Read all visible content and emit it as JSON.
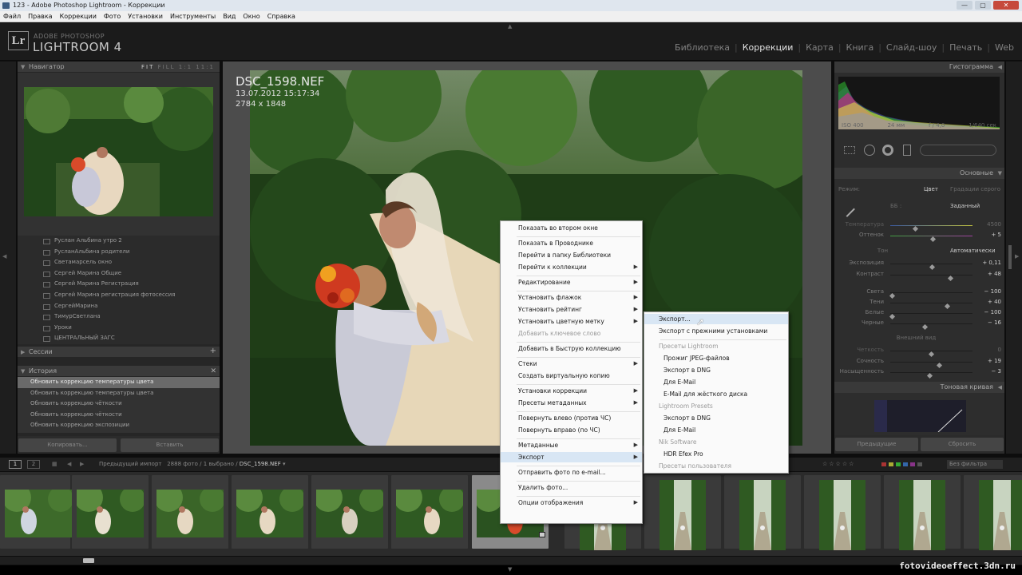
{
  "window": {
    "title": "123 - Adobe Photoshop Lightroom - Коррекции",
    "buttons": [
      "—",
      "▢",
      "✕"
    ]
  },
  "menubar": [
    "Файл",
    "Правка",
    "Коррекции",
    "Фото",
    "Установки",
    "Инструменты",
    "Вид",
    "Окно",
    "Справка"
  ],
  "app": {
    "logo": "Lr",
    "vendor": "ADOBE PHOTOSHOP",
    "name": "LIGHTROOM 4"
  },
  "modules": [
    {
      "label": "Библиотека",
      "active": false
    },
    {
      "label": "Коррекции",
      "active": true
    },
    {
      "label": "Карта",
      "active": false
    },
    {
      "label": "Книга",
      "active": false
    },
    {
      "label": "Слайд-шоу",
      "active": false
    },
    {
      "label": "Печать",
      "active": false
    },
    {
      "label": "Web",
      "active": false
    }
  ],
  "navigator": {
    "title": "Навигатор",
    "opts": [
      "FIT",
      "FILL",
      "1:1",
      "11:1"
    ]
  },
  "collections": [
    "Руслан Альбина утро 2",
    "РусланАльбина родители",
    "Светамарсель окно",
    "Сергей Марина Общие",
    "Сергей Марина Регистрация",
    "Сергей Марина регистрация фотосессия",
    "СергейМарина",
    "ТимурСветлана",
    "Уроки",
    "ЦЕНТРАЛЬНЫЙ ЗАГС"
  ],
  "sessions": {
    "title": "Сессии",
    "plus": "+"
  },
  "history": {
    "title": "История",
    "close": "✕",
    "items": [
      {
        "label": "Обновить коррекцию температуры цвета",
        "selected": true
      },
      {
        "label": "Обновить коррекцию температуры цвета",
        "selected": false
      },
      {
        "label": "Обновить коррекцию чёткости",
        "selected": false
      },
      {
        "label": "Обновить коррекцию чёткости",
        "selected": false
      },
      {
        "label": "Обновить коррекцию экспозиции",
        "selected": false
      }
    ]
  },
  "left_buttons": {
    "copy": "Копировать...",
    "paste": "Вставить"
  },
  "photo": {
    "name": "DSC_1598.NEF",
    "date": "13.07.2012 15:17:34",
    "dims": "2784 x 1848"
  },
  "histogram": {
    "title": "Гистограмма",
    "iso": "ISO 400",
    "focal": "24 мм",
    "aperture": "f / 4,0",
    "shutter": "1/640 сек"
  },
  "basic": {
    "title": "Основные",
    "mode_label": "Режим:",
    "mode_color": "Цвет",
    "mode_bw": "Градации серого",
    "wb_label": "ББ :",
    "wb_value": "Заданный",
    "tone_label": "Тон",
    "tone_auto": "Автоматически",
    "presence_label": "Внешний вид",
    "sliders": [
      {
        "label": "Температура",
        "value": "4500",
        "pos": 0.3,
        "dim": true
      },
      {
        "label": "Оттенок",
        "value": "+ 5",
        "pos": 0.52,
        "dim": false
      },
      {
        "label": "Экспозиция",
        "value": "+ 0,11",
        "pos": 0.51,
        "dim": false
      },
      {
        "label": "Контраст",
        "value": "+ 48",
        "pos": 0.74,
        "dim": false
      },
      {
        "label": "Света",
        "value": "− 100",
        "pos": 0.0,
        "dim": false
      },
      {
        "label": "Тени",
        "value": "+ 40",
        "pos": 0.7,
        "dim": false
      },
      {
        "label": "Белые",
        "value": "− 100",
        "pos": 0.0,
        "dim": false
      },
      {
        "label": "Черные",
        "value": "− 16",
        "pos": 0.42,
        "dim": false
      },
      {
        "label": "Четкость",
        "value": "0",
        "pos": 0.5,
        "dim": true
      },
      {
        "label": "Сочность",
        "value": "+ 19",
        "pos": 0.6,
        "dim": false
      },
      {
        "label": "Насыщенность",
        "value": "− 3",
        "pos": 0.48,
        "dim": false
      }
    ]
  },
  "tone_curve": {
    "title": "Тоновая кривая"
  },
  "right_buttons": {
    "prev": "Предыдущие",
    "reset": "Сбросить"
  },
  "filmstrip": {
    "source": "Предыдущий импорт",
    "count": "2888 фото",
    "selected": "1 выбрано",
    "file": "DSC_1598.NEF",
    "filter": "Без фильтра",
    "pages": [
      "1",
      "2"
    ]
  },
  "context_menu": [
    {
      "label": "Показать во втором окне",
      "sub": false,
      "dis": false
    },
    {
      "sep": true
    },
    {
      "label": "Показать в Проводнике",
      "sub": false,
      "dis": false
    },
    {
      "label": "Перейти в папку Библиотеки",
      "sub": false,
      "dis": false
    },
    {
      "label": "Перейти к коллекции",
      "sub": true,
      "dis": false
    },
    {
      "sep": true
    },
    {
      "label": "Редактирование",
      "sub": true,
      "dis": false
    },
    {
      "sep": true
    },
    {
      "label": "Установить флажок",
      "sub": true,
      "dis": false
    },
    {
      "label": "Установить рейтинг",
      "sub": true,
      "dis": false
    },
    {
      "label": "Установить цветную метку",
      "sub": true,
      "dis": false
    },
    {
      "label": "Добавить ключевое слово",
      "sub": false,
      "dis": true
    },
    {
      "sep": true
    },
    {
      "label": "Добавить в Быструю коллекцию",
      "sub": false,
      "dis": false
    },
    {
      "sep": true
    },
    {
      "label": "Стеки",
      "sub": true,
      "dis": false
    },
    {
      "label": "Создать виртуальную копию",
      "sub": false,
      "dis": false
    },
    {
      "sep": true
    },
    {
      "label": "Установки коррекции",
      "sub": true,
      "dis": false
    },
    {
      "label": "Пресеты метаданных",
      "sub": true,
      "dis": false
    },
    {
      "sep": true
    },
    {
      "label": "Повернуть влево (против ЧС)",
      "sub": false,
      "dis": false
    },
    {
      "label": "Повернуть вправо (по ЧС)",
      "sub": false,
      "dis": false
    },
    {
      "sep": true
    },
    {
      "label": "Метаданные",
      "sub": true,
      "dis": false
    },
    {
      "label": "Экспорт",
      "sub": true,
      "dis": false,
      "hl": true
    },
    {
      "sep": true
    },
    {
      "label": "Отправить фото по e-mail...",
      "sub": false,
      "dis": false
    },
    {
      "sep": true
    },
    {
      "label": "Удалить фото...",
      "sub": false,
      "dis": false
    },
    {
      "sep": true
    },
    {
      "label": "Опции отображения",
      "sub": true,
      "dis": false
    }
  ],
  "export_menu": [
    {
      "label": "Экспорт...",
      "dis": false,
      "hl": true,
      "indent": 0
    },
    {
      "label": "Экспорт с прежними установками",
      "dis": false,
      "indent": 0
    },
    {
      "sep": true
    },
    {
      "label": "Пресеты Lightroom",
      "dis": true,
      "indent": 0
    },
    {
      "label": "Прожиг JPEG-файлов",
      "dis": false,
      "indent": 1
    },
    {
      "label": "Экспорт в DNG",
      "dis": false,
      "indent": 1
    },
    {
      "label": "Для E-Mail",
      "dis": false,
      "indent": 1
    },
    {
      "label": "E-Mail для жёсткого диска",
      "dis": false,
      "indent": 1
    },
    {
      "label": "Lightroom Presets",
      "dis": true,
      "indent": 0
    },
    {
      "label": "Экспорт в DNG",
      "dis": false,
      "indent": 1
    },
    {
      "label": "Для E-Mail",
      "dis": false,
      "indent": 1
    },
    {
      "label": "Nik Software",
      "dis": true,
      "indent": 0
    },
    {
      "label": "HDR Efex Pro",
      "dis": false,
      "indent": 1
    },
    {
      "label": "Пресеты пользователя",
      "dis": true,
      "indent": 0
    }
  ],
  "watermark": "fotovideoeffect.3dn.ru",
  "colors": {
    "accent_active": "#e3e3e3",
    "panel": "#323232",
    "menu_highlight": "#d8e6f4"
  }
}
